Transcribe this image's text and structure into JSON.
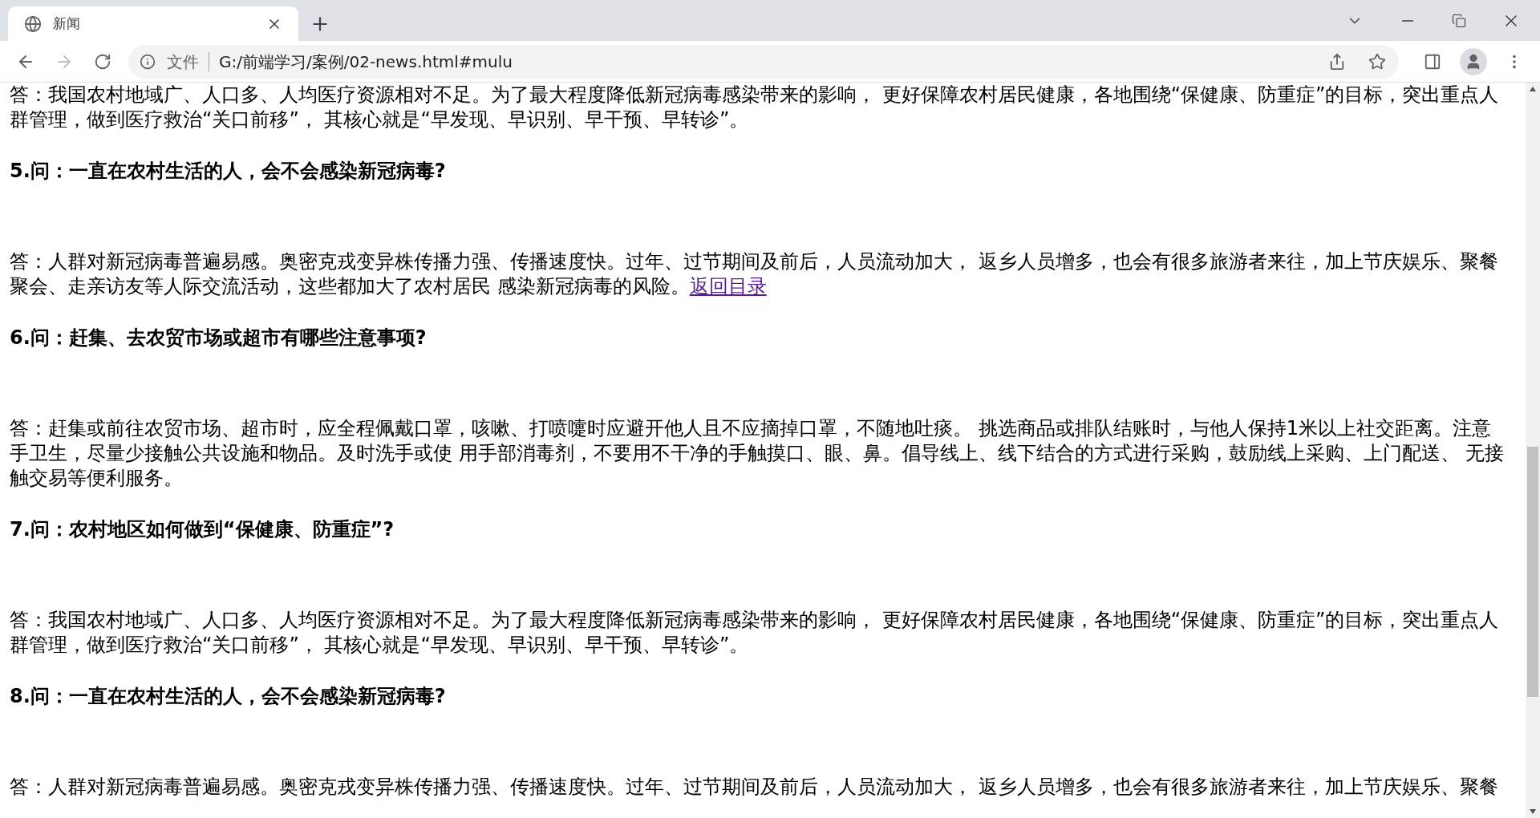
{
  "tab": {
    "title": "新闻",
    "selected": true
  },
  "address_bar": {
    "scheme_label": "文件",
    "url": "G:/前端学习/案例/02-news.html#mulu"
  },
  "blocks": [
    {
      "kind": "answer",
      "text": "答：我国农村地域广、人口多、人均医疗资源相对不足。为了最大程度降低新冠病毒感染带来的影响， 更好保障农村居民健康，各地围绕“保健康、防重症”的目标，突出重点人群管理，做到医疗救治“关口前移”， 其核心就是“早发现、早识别、早干预、早转诊”。"
    },
    {
      "kind": "question",
      "text": "5.问：一直在农村生活的人，会不会感染新冠病毒?"
    },
    {
      "kind": "answer",
      "text": "答：人群对新冠病毒普遍易感。奥密克戎变异株传播力强、传播速度快。过年、过节期间及前后，人员流动加大， 返乡人员增多，也会有很多旅游者来往，加上节庆娱乐、聚餐聚会、走亲访友等人际交流活动，这些都加大了农村居民 感染新冠病毒的风险。",
      "link": "返回目录"
    },
    {
      "kind": "question",
      "text": "6.问：赶集、去农贸市场或超市有哪些注意事项?"
    },
    {
      "kind": "answer",
      "text": "答：赶集或前往农贸市场、超市时，应全程佩戴口罩，咳嗽、打喷嚏时应避开他人且不应摘掉口罩，不随地吐痰。 挑选商品或排队结账时，与他人保持1米以上社交距离。注意手卫生，尽量少接触公共设施和物品。及时洗手或使 用手部消毒剂，不要用不干净的手触摸口、眼、鼻。倡导线上、线下结合的方式进行采购，鼓励线上采购、上门配送、 无接触交易等便利服务。"
    },
    {
      "kind": "question",
      "text": "7.问：农村地区如何做到“保健康、防重症”?"
    },
    {
      "kind": "answer",
      "text": "答：我国农村地域广、人口多、人均医疗资源相对不足。为了最大程度降低新冠病毒感染带来的影响， 更好保障农村居民健康，各地围绕“保健康、防重症”的目标，突出重点人群管理，做到医疗救治“关口前移”， 其核心就是“早发现、早识别、早干预、早转诊”。"
    },
    {
      "kind": "question",
      "text": "8.问：一直在农村生活的人，会不会感染新冠病毒?"
    },
    {
      "kind": "answer",
      "text": "答：人群对新冠病毒普遍易感。奥密克戎变异株传播力强、传播速度快。过年、过节期间及前后，人员流动加大， 返乡人员增多，也会有很多旅游者来往，加上节庆娱乐、聚餐"
    }
  ]
}
